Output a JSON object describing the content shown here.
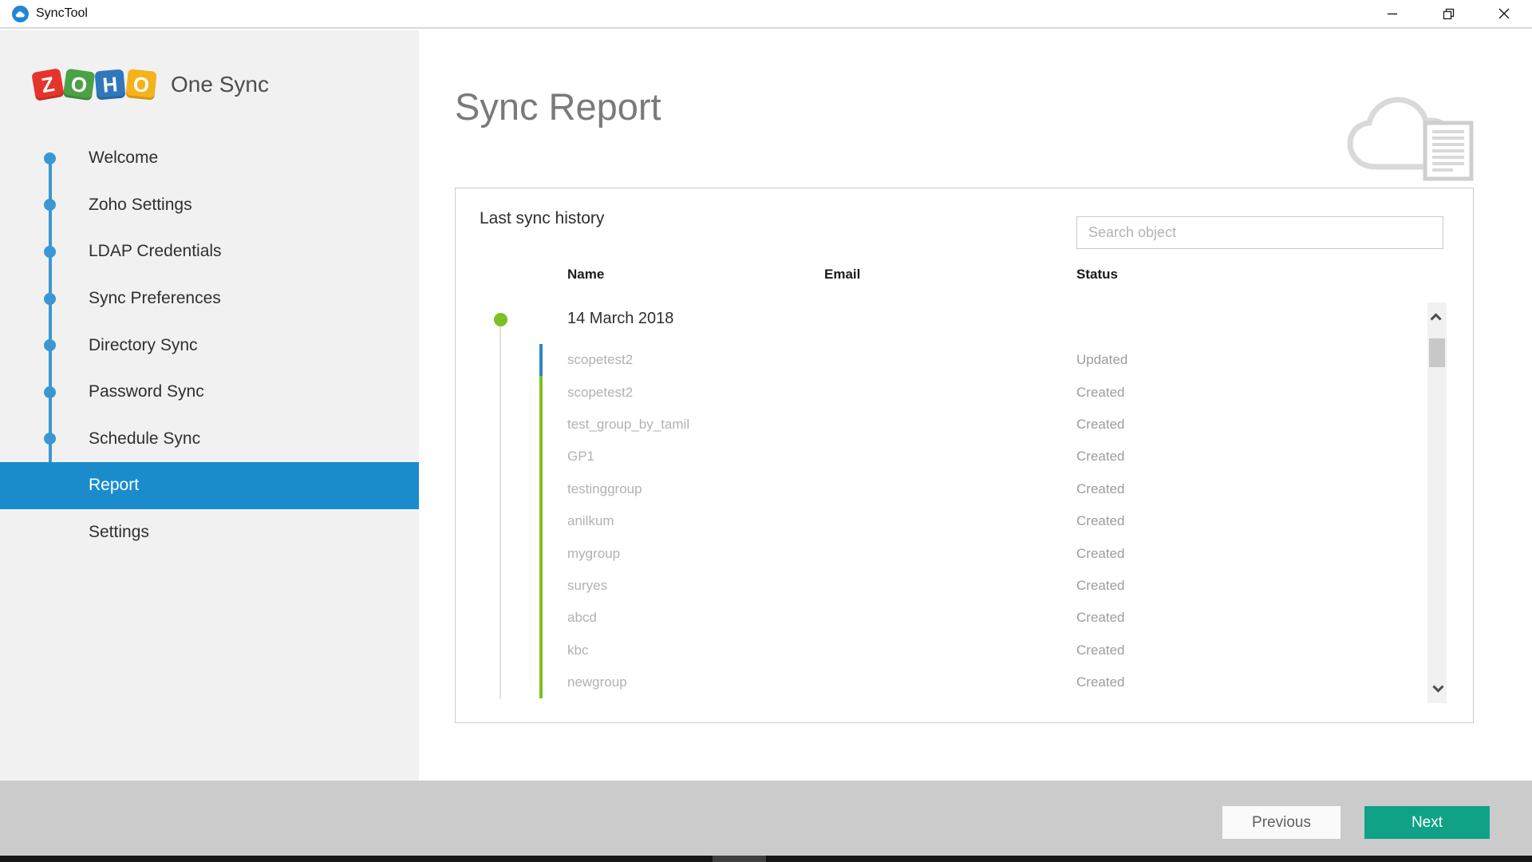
{
  "window": {
    "title": "SyncTool"
  },
  "sidebar": {
    "brand": {
      "letters": [
        {
          "char": "Z",
          "color": "#e5342c"
        },
        {
          "char": "O",
          "color": "#4ba146"
        },
        {
          "char": "H",
          "color": "#3177bd"
        },
        {
          "char": "O",
          "color": "#f5b31b"
        }
      ],
      "title": "One Sync"
    },
    "items": [
      {
        "label": "Welcome",
        "dot": true,
        "active": false
      },
      {
        "label": "Zoho Settings",
        "dot": true,
        "active": false
      },
      {
        "label": "LDAP Credentials",
        "dot": true,
        "active": false
      },
      {
        "label": "Sync Preferences",
        "dot": true,
        "active": false
      },
      {
        "label": "Directory Sync",
        "dot": true,
        "active": false
      },
      {
        "label": "Password Sync",
        "dot": true,
        "active": false
      },
      {
        "label": "Schedule Sync",
        "dot": true,
        "active": false
      },
      {
        "label": "Report",
        "dot": false,
        "active": true
      },
      {
        "label": "Settings",
        "dot": false,
        "active": false
      }
    ]
  },
  "main": {
    "title": "Sync Report",
    "panel": {
      "heading": "Last sync history",
      "search": {
        "placeholder": "Search object"
      },
      "columns": {
        "name": "Name",
        "email": "Email",
        "status": "Status"
      },
      "group_date": "14 March 2018",
      "rows": [
        {
          "name": "scopetest2",
          "email": "",
          "status": "Updated",
          "accent": "accent_blue"
        },
        {
          "name": "scopetest2",
          "email": "",
          "status": "Created",
          "accent": "accent_green"
        },
        {
          "name": "test_group_by_tamil",
          "email": "",
          "status": "Created",
          "accent": "accent_green"
        },
        {
          "name": "GP1",
          "email": "",
          "status": "Created",
          "accent": "accent_green"
        },
        {
          "name": "testinggroup",
          "email": "",
          "status": "Created",
          "accent": "accent_green"
        },
        {
          "name": "anilkum",
          "email": "",
          "status": "Created",
          "accent": "accent_green"
        },
        {
          "name": "mygroup",
          "email": "",
          "status": "Created",
          "accent": "accent_green"
        },
        {
          "name": "suryes",
          "email": "",
          "status": "Created",
          "accent": "accent_green"
        },
        {
          "name": "abcd",
          "email": "",
          "status": "Created",
          "accent": "accent_green"
        },
        {
          "name": "kbc",
          "email": "",
          "status": "Created",
          "accent": "accent_green"
        },
        {
          "name": "newgroup",
          "email": "",
          "status": "Created",
          "accent": "accent_green"
        }
      ]
    }
  },
  "footer": {
    "previous_label": "Previous",
    "next_label": "Next"
  },
  "colors": {
    "active_blue": "#1a8ccc",
    "stepper_blue": "#3a97d4",
    "timeline_green": "#7cc123",
    "accent_green": "#7cc123",
    "accent_blue": "#2d87c9",
    "next_teal": "#0fa287",
    "footer_gray": "#cbcbcb",
    "app_icon_blue": "#1e88d2"
  }
}
